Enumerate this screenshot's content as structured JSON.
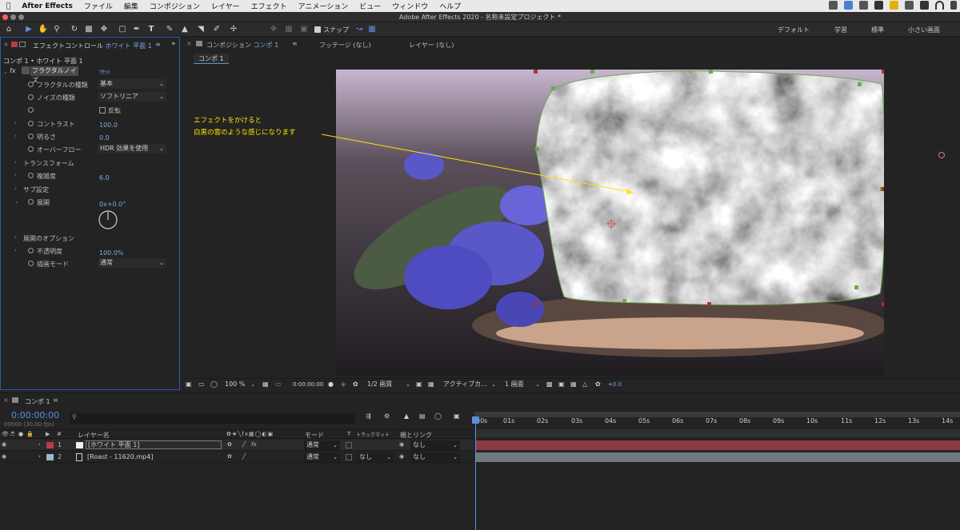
{
  "menubar": {
    "app": "After Effects",
    "items": [
      "ファイル",
      "編集",
      "コンポジション",
      "レイヤー",
      "エフェクト",
      "アニメーション",
      "ビュー",
      "ウィンドウ",
      "ヘルプ"
    ]
  },
  "window": {
    "title": "Adobe After Effects 2020 - 名称未設定プロジェクト *"
  },
  "toolbar": {
    "snap_label": "スナップ"
  },
  "workspaces": [
    "デフォルト",
    "学習",
    "標準",
    "小さい画面"
  ],
  "effect_panel": {
    "tab_prefix": "エフェクトコントロール",
    "tab_layer": "ホワイト 平面 1",
    "breadcrumb": "コンポ 1 • ホワイト 平面 1",
    "effect_name": "フラクタルノイズ",
    "reset": "ﾘｾｯﾄ",
    "rows": {
      "fractal_type": {
        "label": "フラクタルの種類",
        "value": "基本"
      },
      "noise_type": {
        "label": "ノイズの種類",
        "value": "ソフトリニア"
      },
      "invert": {
        "label": "反転"
      },
      "contrast": {
        "label": "コントラスト",
        "value": "100.0"
      },
      "brightness": {
        "label": "明るさ",
        "value": "0.0"
      },
      "overflow": {
        "label": "オーバーフロー",
        "value": "HDR 効果を使用"
      },
      "transform": {
        "label": "トランスフォーム"
      },
      "complexity": {
        "label": "複雑度",
        "value": "6.0"
      },
      "sub_settings": {
        "label": "サブ設定"
      },
      "evolution": {
        "label": "展開",
        "value": "0x+0.0°"
      },
      "evolution_options": {
        "label": "展開のオプション"
      },
      "opacity": {
        "label": "不透明度",
        "value": "100.0%"
      },
      "blend_mode": {
        "label": "描画モード",
        "value": "通常"
      }
    }
  },
  "comp_panel": {
    "tabs": {
      "composition_prefix": "コンポジション",
      "composition_name": "コンポ 1",
      "footage": "フッテージ (なし)",
      "layer": "レイヤー (なし)"
    },
    "sub_tab": "コンポ 1",
    "annotation": {
      "line1": "エフェクトをかけると",
      "line2": "白黒の雲のような感じになります"
    },
    "bottom_bar": {
      "zoom": "100 %",
      "timecode": "0:00:00:00",
      "resolution": "1/2 画質",
      "camera": "アクティブカ...",
      "views": "1 画面",
      "exposure": "+0.0"
    }
  },
  "timeline": {
    "tab": "コンポ 1",
    "timecode": "0:00:00:00",
    "frames": "00000 (30.00 fps)",
    "columns": {
      "layer_name": "レイヤー名",
      "mode": "モード",
      "t": "T",
      "trkmat": "トラックマット",
      "parent": "親とリンク"
    },
    "ruler": [
      "00s",
      "01s",
      "02s",
      "03s",
      "04s",
      "05s",
      "06s",
      "07s",
      "08s",
      "09s",
      "10s",
      "11s",
      "12s",
      "13s",
      "14s"
    ],
    "layers": [
      {
        "num": "1",
        "name": "[ホワイト 平面 1]",
        "mode": "通常",
        "trkmat": "",
        "parent": "なし",
        "label_color": "#c0393b"
      },
      {
        "num": "2",
        "name": "[Roast - 11620.mp4]",
        "mode": "通常",
        "trkmat": "なし",
        "parent": "なし",
        "label_color": "#9fb8c8"
      }
    ]
  },
  "colors": {
    "accent_blue": "#2d5aa8",
    "value_blue": "#7ea8e6",
    "layer1_bar": "#8b3a42",
    "layer2_bar": "#6e7a80",
    "annotation": "#ffe400"
  }
}
